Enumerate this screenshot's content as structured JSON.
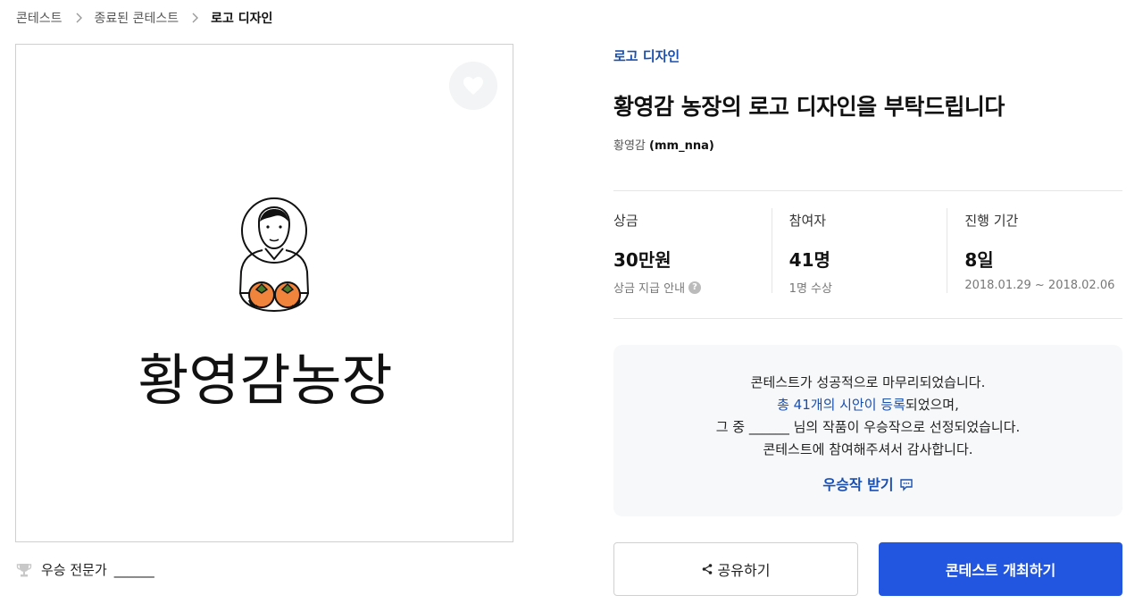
{
  "breadcrumb": {
    "items": [
      "콘테스트",
      "종료된 콘테스트",
      "로고 디자인"
    ]
  },
  "image_panel": {
    "logo_text": "황영감농장"
  },
  "winner": {
    "label": "우승 전문가",
    "name": "______"
  },
  "contest": {
    "category": "로고 디자인",
    "title": "황영감 농장의 로고 디자인을 부탁드립니다",
    "host_name": "황영감",
    "host_handle": "(mm_nna)"
  },
  "stats": {
    "prize_label": "상금",
    "prize_value": "30만원",
    "prize_sub": "상금 지급 안내",
    "participants_label": "참여자",
    "participants_value": "41명",
    "participants_sub": "1명 수상",
    "period_label": "진행 기간",
    "period_value": "8일",
    "period_sub": "2018.01.29 ~ 2018.02.06"
  },
  "result": {
    "line1": "콘테스트가 성공적으로 마무리되었습니다.",
    "line2_link": "총 41개의 시안이 등록",
    "line2_rest": "되었으며,",
    "line3": "그 중 ______ 님의 작품이 우승작으로 선정되었습니다.",
    "line4": "콘테스트에 참여해주셔서 감사합니다.",
    "receive_label": "우승작 받기"
  },
  "buttons": {
    "share_label": "공유하기",
    "host_label": "콘테스트 개최하기"
  },
  "colors": {
    "accent": "#1a4fb0",
    "primary_button": "#2255e0",
    "persimmon": "#f0843c"
  }
}
